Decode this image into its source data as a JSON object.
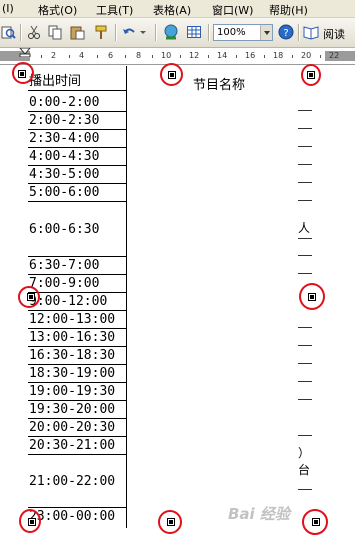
{
  "menubar": {
    "items": [
      "(I)",
      "格式(O)",
      "工具(T)",
      "表格(A)",
      "窗口(W)",
      "帮助(H)"
    ]
  },
  "toolbar": {
    "zoom": "100%",
    "read_label": "阅读"
  },
  "ruler": {
    "numbers": [
      "2",
      "4",
      "6",
      "8",
      "10",
      "12",
      "14",
      "16",
      "18",
      "20",
      "22"
    ]
  },
  "table": {
    "header_time": "播出时间",
    "header_name": "节目名称",
    "times": [
      "0:00-2:00",
      "2:00-2:30",
      "2:30-4:00",
      "4:00-4:30",
      "4:30-5:00",
      "5:00-6:00",
      "6:00-6:30",
      "6:30-7:00",
      "7:00-9:00",
      "9:00-12:00",
      "12:00-13:00",
      "13:00-16:30",
      "16:30-18:30",
      "18:30-19:00",
      "19:00-19:30",
      "19:30-20:00",
      "20:00-20:30",
      "20:30-21:00",
      "21:00-22:00",
      "23:00-00:00"
    ],
    "right_fragments": [
      "人",
      "）",
      "台"
    ]
  },
  "watermark": "Bai 经验"
}
